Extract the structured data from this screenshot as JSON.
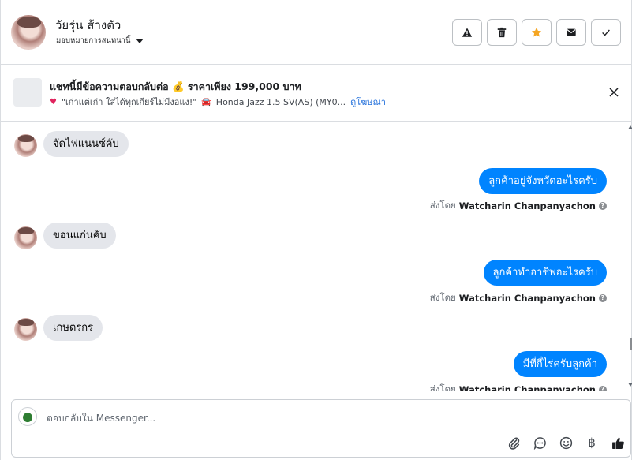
{
  "header": {
    "contact_name": "วัยรุ่น ส้างตัว",
    "assign_label": "มอบหมายการสนทนานี้",
    "actions": [
      {
        "name": "warning-icon"
      },
      {
        "name": "trash-icon"
      },
      {
        "name": "star-icon",
        "color": "#f5a623"
      },
      {
        "name": "envelope-icon"
      },
      {
        "name": "check-icon"
      }
    ]
  },
  "ad": {
    "title": "แชทนี้มีข้อความตอบกลับต่อ 💰 ราคาเพียง 199,000 บาท",
    "subtitle": "\"เก่าแต่เก๋า ใส่ได้ทุกเกียร์ไม่มีงอแง!\"",
    "car_text": "Honda Jazz 1.5 SV(AS) (MY0...",
    "link": "ดูโฆษณา"
  },
  "messages": [
    {
      "dir": "in",
      "text": "จัดไฟแนนซ์คับ"
    },
    {
      "dir": "out",
      "text": "ลูกค้าอยู่จังหวัดอะไรครับ",
      "sent_by_label": "ส่งโดย",
      "sender": "Watcharin Chanpanyachon"
    },
    {
      "dir": "in",
      "text": "ขอนแก่นคับ"
    },
    {
      "dir": "out",
      "text": "ลูกค้าทำอาชีพอะไรครับ",
      "sent_by_label": "ส่งโดย",
      "sender": "Watcharin Chanpanyachon"
    },
    {
      "dir": "in",
      "text": "เกษตรกร"
    },
    {
      "dir": "out",
      "text": "มีที่กี่ไร่ครับลูกค้า",
      "sent_by_label": "ส่งโดย",
      "sender": "Watcharin Chanpanyachon"
    }
  ],
  "composer": {
    "placeholder": "ตอบกลับใน Messenger...",
    "tools": [
      "attachment-icon",
      "saved-reply-icon",
      "emoji-icon",
      "payment-icon",
      "like-icon"
    ],
    "currency_symbol": "฿"
  },
  "colors": {
    "outgoing_bubble": "#0084ff",
    "incoming_bubble": "#e4e6eb",
    "link": "#216fdb"
  }
}
